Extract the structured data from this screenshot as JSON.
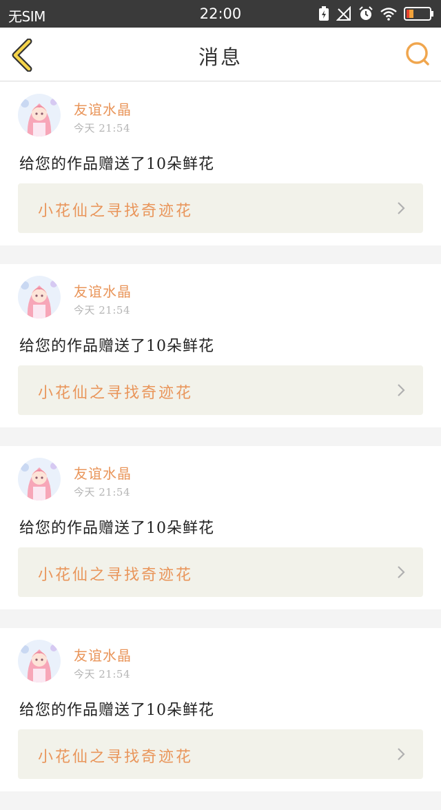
{
  "status_bar": {
    "carrier": "无SIM",
    "time": "22:00",
    "icons": [
      "battery-saver-icon",
      "no-signal-icon",
      "alarm-icon",
      "wifi-icon",
      "battery-icon"
    ],
    "battery_level": 0.3,
    "text_color": "#ffffff",
    "background": "#3a3a3a"
  },
  "nav": {
    "title": "消息",
    "back_icon": "chevron-left-icon",
    "search_icon": "search-icon",
    "accent_color": "#f0a64e"
  },
  "messages": [
    {
      "sender": "友谊水晶",
      "time": "今天 21:54",
      "text": "给您的作品赠送了10朵鲜花",
      "work_title": "小花仙之寻找奇迹花"
    },
    {
      "sender": "友谊水晶",
      "time": "今天 21:54",
      "text": "给您的作品赠送了10朵鲜花",
      "work_title": "小花仙之寻找奇迹花"
    },
    {
      "sender": "友谊水晶",
      "time": "今天 21:54",
      "text": "给您的作品赠送了10朵鲜花",
      "work_title": "小花仙之寻找奇迹花"
    },
    {
      "sender": "友谊水晶",
      "time": "今天 21:54",
      "text": "给您的作品赠送了10朵鲜花",
      "work_title": "小花仙之寻找奇迹花"
    }
  ],
  "colors": {
    "name_orange": "#e9955a",
    "link_bg": "#f2f2ea",
    "page_bg": "#f4f4f4"
  }
}
